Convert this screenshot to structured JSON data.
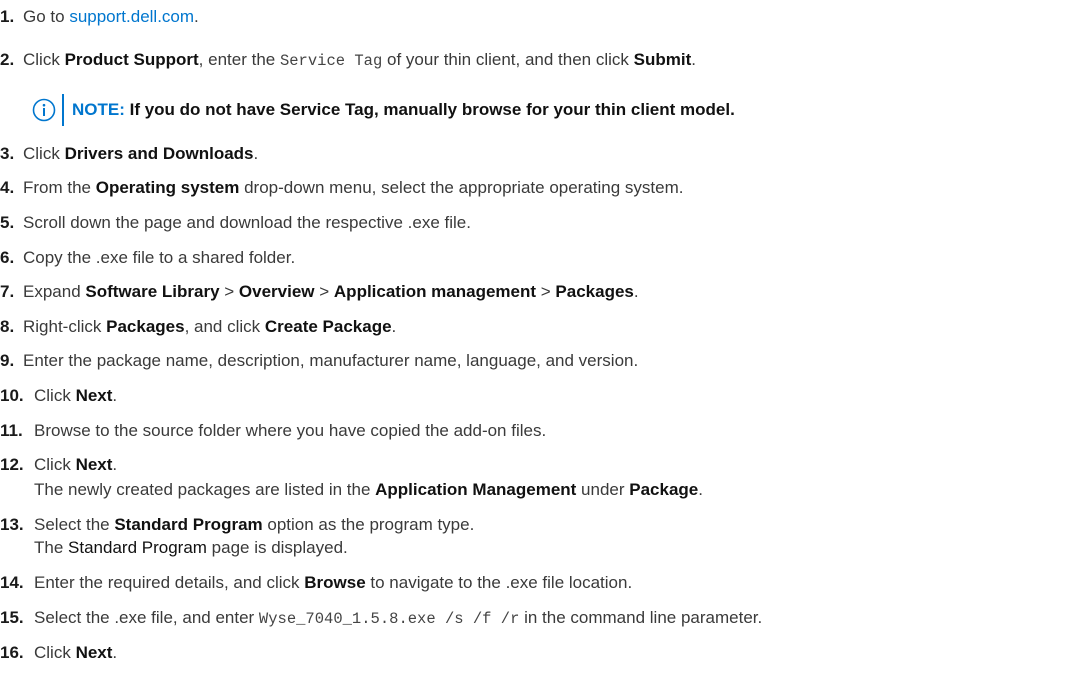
{
  "steps": [
    {
      "n": "1.",
      "a": "Go to ",
      "link": "support.dell.com",
      "b": "."
    },
    {
      "n": "2.",
      "a": "Click ",
      "b1": "Product Support",
      "c": ", enter the ",
      "code": "Service Tag",
      "d": " of your thin client, and then click ",
      "b2": "Submit",
      "e": "."
    },
    {
      "n": "3.",
      "a": "Click ",
      "b1": "Drivers and Downloads",
      "e": "."
    },
    {
      "n": "4.",
      "a": "From the ",
      "b1": "Operating system",
      "e": " drop-down menu, select the appropriate operating system."
    },
    {
      "n": "5.",
      "a": "Scroll down the page and download the respective .exe file."
    },
    {
      "n": "6.",
      "a": "Copy the .exe file to a shared folder."
    },
    {
      "n": "7.",
      "a": "Expand ",
      "b1": "Software Library",
      "s1": " > ",
      "b2": "Overview",
      "s2": " > ",
      "b3": "Application management",
      "s3": " > ",
      "b4": "Packages",
      "e": "."
    },
    {
      "n": "8.",
      "a": "Right-click ",
      "b1": "Packages",
      "c": ", and click ",
      "b2": "Create Package",
      "e": "."
    },
    {
      "n": "9.",
      "a": "Enter the package name, description, manufacturer name, language, and version."
    },
    {
      "n": "10.",
      "a": "Click ",
      "b1": "Next",
      "e": "."
    },
    {
      "n": "11.",
      "a": "Browse to the source folder where you have copied the add-on files."
    },
    {
      "n": "12.",
      "a": "Click ",
      "b1": "Next",
      "e": "."
    },
    {
      "n": "13.",
      "a": "Select the ",
      "b1": "Standard Program",
      "e": " option as the program type."
    },
    {
      "n": "14.",
      "a": "Enter the required details, and click ",
      "b1": "Browse",
      "e": " to navigate to the .exe file location."
    },
    {
      "n": "15.",
      "a": "Select the .exe file, and enter ",
      "code": "Wyse_7040_1.5.8.exe /s /f /r",
      "e": " in the command line parameter."
    },
    {
      "n": "16.",
      "a": "Click ",
      "b1": "Next",
      "e": "."
    }
  ],
  "note": {
    "label": "NOTE:",
    "text": " If you do not have Service Tag, manually browse for your thin client model."
  },
  "sub12": {
    "a": "The newly created packages are listed in the ",
    "b1": "Application Management",
    "c": " under ",
    "b2": "Package",
    "e": "."
  },
  "sub13": {
    "a": "The ",
    "b1": "Standard Program",
    "e": " page is displayed."
  },
  "colors": {
    "link": "#0076ce",
    "note_accent": "#0076ce"
  },
  "icons": {
    "note": "info-circle-icon"
  }
}
